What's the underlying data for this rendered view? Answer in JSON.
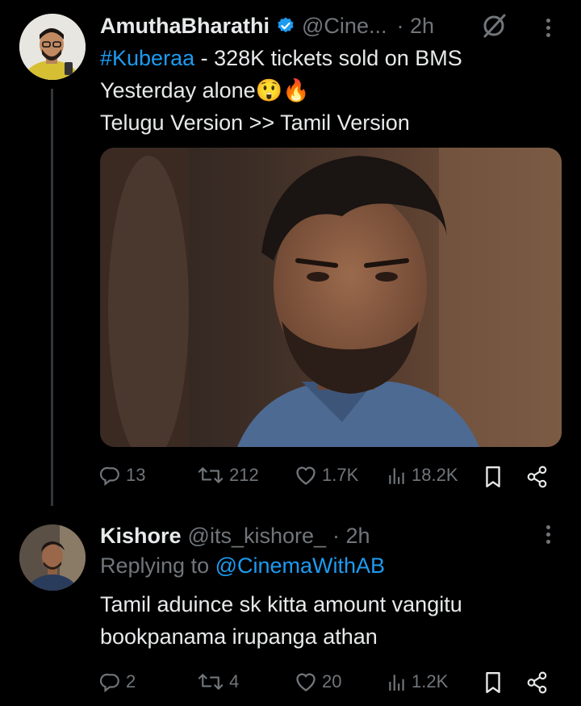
{
  "tweet1": {
    "display_name": "AmuthaBharathi",
    "handle": "@Cine...",
    "time": "· 2h",
    "hashtag": "#Kuberaa",
    "line1_rest": " - 328K tickets sold on BMS",
    "line2": "Yesterday alone😲🔥",
    "line3": "Telugu Version >> Tamil Version",
    "replies": "13",
    "reposts": "212",
    "likes": "1.7K",
    "views": "18.2K"
  },
  "tweet2": {
    "display_name": "Kishore",
    "handle": "@its_kishore_",
    "time": "· 2h",
    "replying_prefix": "Replying to ",
    "replying_handle": "@CinemaWithAB",
    "line1": "Tamil aduince sk kitta amount vangitu",
    "line2": "bookpanama irupanga athan",
    "replies": "2",
    "reposts": "4",
    "likes": "20",
    "views": "1.2K"
  },
  "icons": {
    "verified": "verified-badge-icon",
    "grok": "grok-icon",
    "more": "more-options-icon",
    "reply": "reply-icon",
    "repost": "repost-icon",
    "like": "like-icon",
    "views": "views-icon",
    "bookmark": "bookmark-icon",
    "share": "share-icon"
  },
  "colors": {
    "background": "#000000",
    "text": "#e7e9ea",
    "muted": "#71767b",
    "accent": "#1d9bf0"
  }
}
